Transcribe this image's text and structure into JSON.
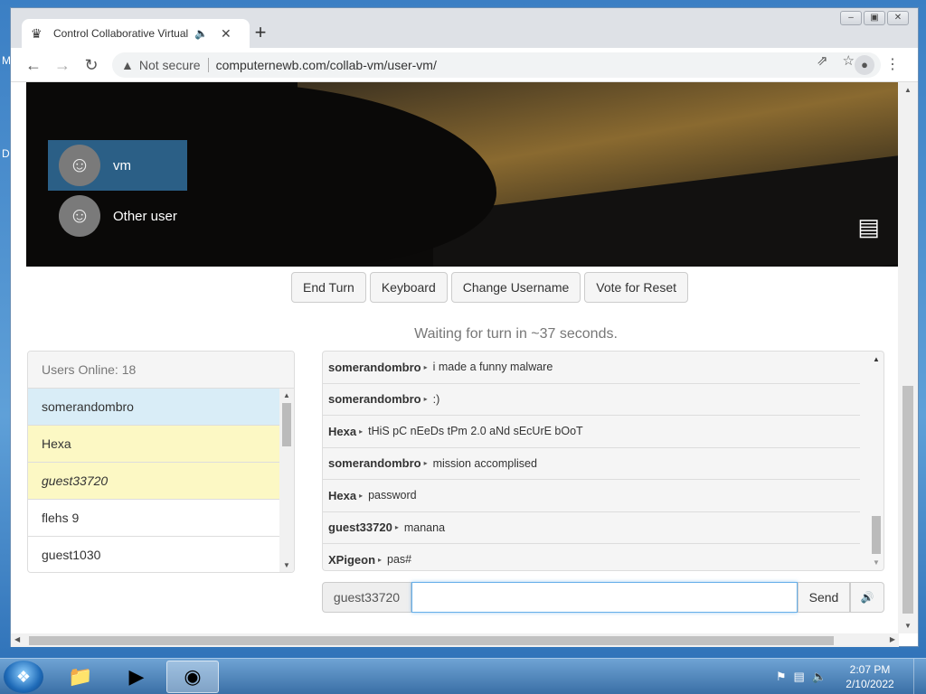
{
  "browser": {
    "tab_title": "Control Collaborative Virtual",
    "address_security": "Not secure",
    "address_url": "computernewb.com/collab-vm/user-vm/"
  },
  "desktop": {
    "left_letters": [
      "M",
      "D"
    ]
  },
  "vm": {
    "login_users": [
      {
        "name": "vm",
        "selected": true
      },
      {
        "name": "Other user",
        "selected": false
      }
    ]
  },
  "controls": {
    "buttons": [
      "End Turn",
      "Keyboard",
      "Change Username",
      "Vote for Reset"
    ],
    "waiting_text": "Waiting for turn in ~37 seconds."
  },
  "users_panel": {
    "header": "Users Online: 18",
    "users": [
      {
        "name": "somerandombro",
        "style": "blue"
      },
      {
        "name": "Hexa",
        "style": "yellow"
      },
      {
        "name": "guest33720",
        "style": "yellow-italic"
      },
      {
        "name": "flehs 9",
        "style": "plain"
      },
      {
        "name": "guest1030",
        "style": "plain"
      }
    ]
  },
  "chat": {
    "messages": [
      {
        "user": "somerandombro",
        "text": "i made a funny malware"
      },
      {
        "user": "somerandombro",
        "text": ":)"
      },
      {
        "user": "Hexa",
        "text": "tHiS pC nEeDs tPm 2.0 aNd sEcUrE bOoT"
      },
      {
        "user": "somerandombro",
        "text": "mission accomplised"
      },
      {
        "user": "Hexa",
        "text": "password"
      },
      {
        "user": "guest33720",
        "text": "manana"
      },
      {
        "user": "XPigeon",
        "text": "pas#"
      }
    ],
    "username_label": "guest33720",
    "input_value": "",
    "send_label": "Send"
  },
  "taskbar": {
    "time": "2:07 PM",
    "date": "2/10/2022"
  },
  "colors": {
    "selected_user_bg": "#2b5f86",
    "users_highlight_blue": "#d9edf7",
    "users_highlight_yellow": "#fcf8c4"
  }
}
